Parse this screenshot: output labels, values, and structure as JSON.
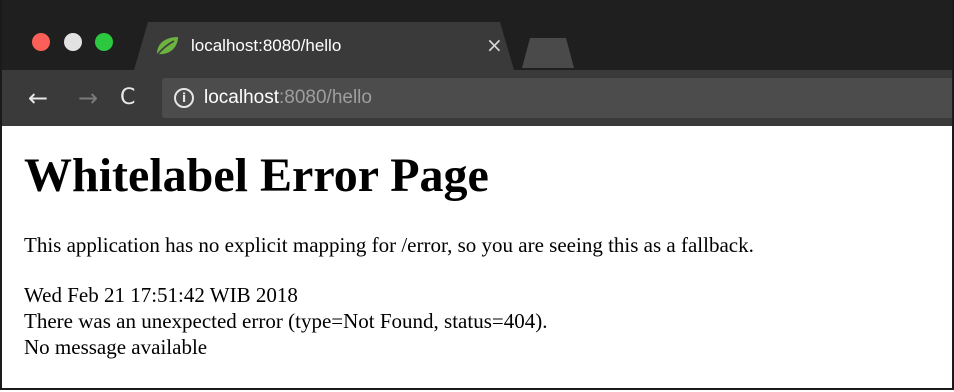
{
  "browser": {
    "tab": {
      "title": "localhost:8080/hello",
      "close_glyph": "×",
      "favicon": "spring-leaf-icon"
    },
    "toolbar": {
      "back_glyph": "←",
      "forward_glyph": "→",
      "reload_glyph": "C",
      "info_glyph": "i",
      "url_host": "localhost",
      "url_rest": ":8080/hello"
    },
    "colors": {
      "tabstrip": "#1f1f1f",
      "toolbar": "#3a3a3a",
      "omnibox": "#4c4c4c",
      "close_red": "#fc5f57",
      "minimize_gray": "#e2e2e2",
      "maximize_green": "#2bc840",
      "spring_green": "#6db33f"
    }
  },
  "page": {
    "heading": "Whitelabel Error Page",
    "message": "This application has no explicit mapping for /error, so you are seeing this as a fallback.",
    "timestamp": "Wed Feb 21 17:51:42 WIB 2018",
    "error_detail": "There was an unexpected error (type=Not Found, status=404).",
    "status_message": "No message available"
  }
}
